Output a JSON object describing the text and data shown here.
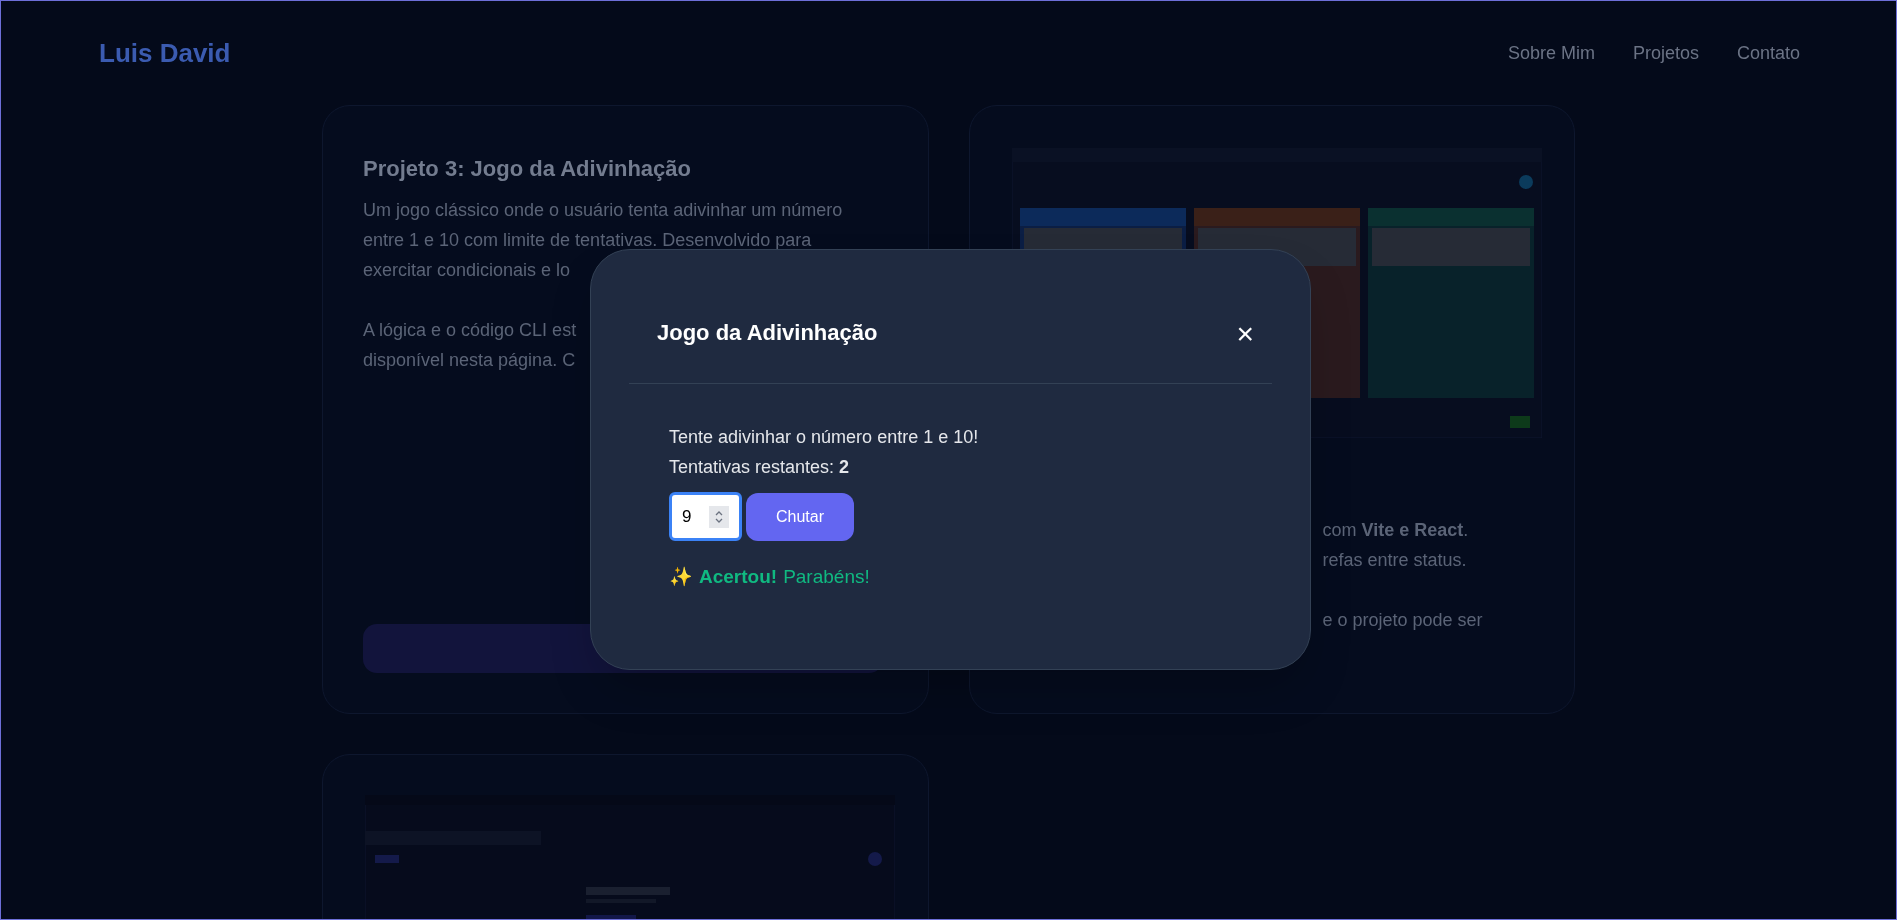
{
  "header": {
    "logo": "Luis David",
    "nav": [
      "Sobre Mim",
      "Projetos",
      "Contato"
    ]
  },
  "left_card": {
    "title": "Projeto 3: Jogo da Adivinhação",
    "paragraph_1": [
      "Um jogo clássico onde o usuário tenta adivinhar um número",
      "entre 1 e 10 com limite de tentativas. Desenvolvido para",
      "exercitar condicionais e lo"
    ],
    "paragraph_2": [
      "A lógica e o código CLI est",
      "disponível nesta página. C"
    ]
  },
  "right_card": {
    "paragraph_1": [
      "com **Vite e React**.",
      "refas entre status."
    ],
    "paragraph_2": [
      "e o projeto pode ser"
    ]
  },
  "modal": {
    "title": "Jogo da Adivinhação",
    "close": "×",
    "prompt": "Tente adivinhar o número entre 1 e 10!",
    "attempts": "Tentativas restantes: **2**",
    "input_value": "9",
    "button": "Chutar",
    "result_icon": "✨",
    "result_strong": "Acertou!",
    "result_rest": "Parabéns!"
  }
}
